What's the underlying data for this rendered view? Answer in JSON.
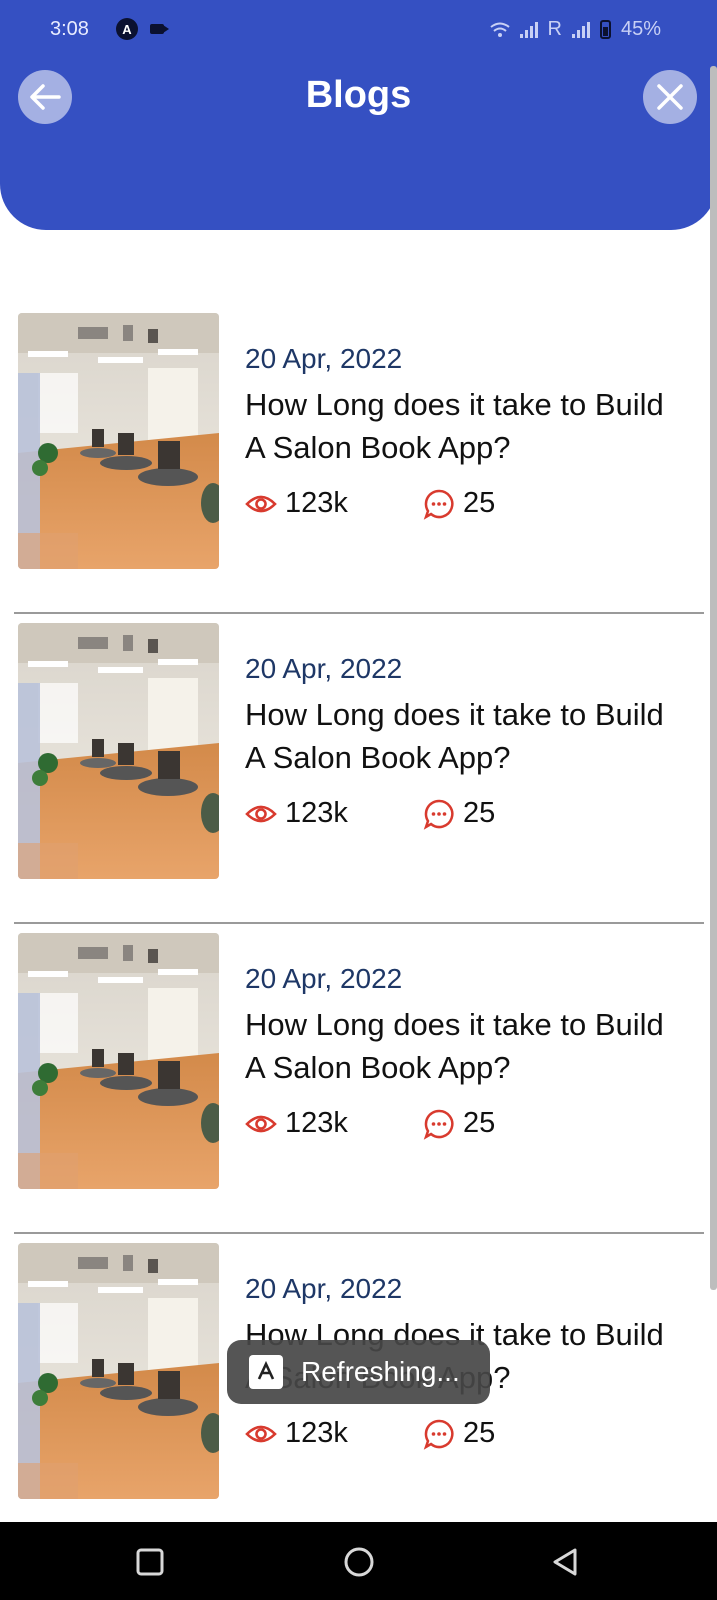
{
  "status_bar": {
    "time": "3:08",
    "carrier_r": "R",
    "battery": "45%"
  },
  "header": {
    "title": "Blogs",
    "back_icon": "arrow-left-icon",
    "close_icon": "close-icon",
    "color": "#3550c2"
  },
  "blogs": [
    {
      "date": "20 Apr, 2022",
      "title_line1": "How Long does it take to Build",
      "title_line2": "A Salon Book App?",
      "views": "123k",
      "comments": "25"
    },
    {
      "date": "20 Apr, 2022",
      "title_line1": "How Long does it take to Build",
      "title_line2": "A Salon Book App?",
      "views": "123k",
      "comments": "25"
    },
    {
      "date": "20 Apr, 2022",
      "title_line1": "How Long does it take to Build",
      "title_line2": "A Salon Book App?",
      "views": "123k",
      "comments": "25"
    },
    {
      "date": "20 Apr, 2022",
      "title_line1": "How Long does it take to Build",
      "title_line2": "A Salon Book App?",
      "views": "123k",
      "comments": "25"
    }
  ],
  "toast": {
    "text": "Refreshing..."
  },
  "accent_color": "#d83a2e",
  "nav": {
    "recent_icon": "square-icon",
    "home_icon": "circle-icon",
    "back_icon": "triangle-back-icon"
  }
}
